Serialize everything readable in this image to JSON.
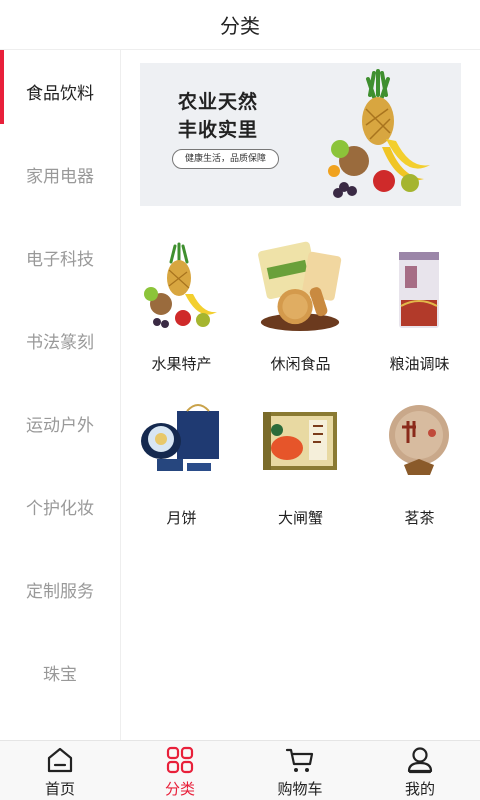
{
  "header": {
    "title": "分类"
  },
  "sidebar": {
    "items": [
      {
        "label": "食品饮料",
        "active": true
      },
      {
        "label": "家用电器",
        "active": false
      },
      {
        "label": "电子科技",
        "active": false
      },
      {
        "label": "书法篆刻",
        "active": false
      },
      {
        "label": "运动户外",
        "active": false
      },
      {
        "label": "个护化妆",
        "active": false
      },
      {
        "label": "定制服务",
        "active": false
      },
      {
        "label": "珠宝",
        "active": false
      }
    ]
  },
  "banner": {
    "line1": "农业天然",
    "line2": "丰收实里",
    "pill": "健康生活，品质保障"
  },
  "categories": [
    {
      "label": "水果特产",
      "icon": "fruit-basket-icon"
    },
    {
      "label": "休闲食品",
      "icon": "snack-biscuit-icon"
    },
    {
      "label": "粮油调味",
      "icon": "rice-bag-icon"
    },
    {
      "label": "月饼",
      "icon": "mooncake-gift-box-icon"
    },
    {
      "label": "大闸蟹",
      "icon": "crab-gift-box-icon"
    },
    {
      "label": "茗茶",
      "icon": "tea-cake-icon"
    }
  ],
  "tabbar": {
    "items": [
      {
        "label": "首页",
        "icon": "home-icon",
        "active": false
      },
      {
        "label": "分类",
        "icon": "category-grid-icon",
        "active": true
      },
      {
        "label": "购物车",
        "icon": "cart-icon",
        "active": false
      },
      {
        "label": "我的",
        "icon": "user-icon",
        "active": false
      }
    ]
  },
  "colors": {
    "accent": "#e8203a",
    "sidebar_text": "#999999",
    "text": "#222222"
  }
}
